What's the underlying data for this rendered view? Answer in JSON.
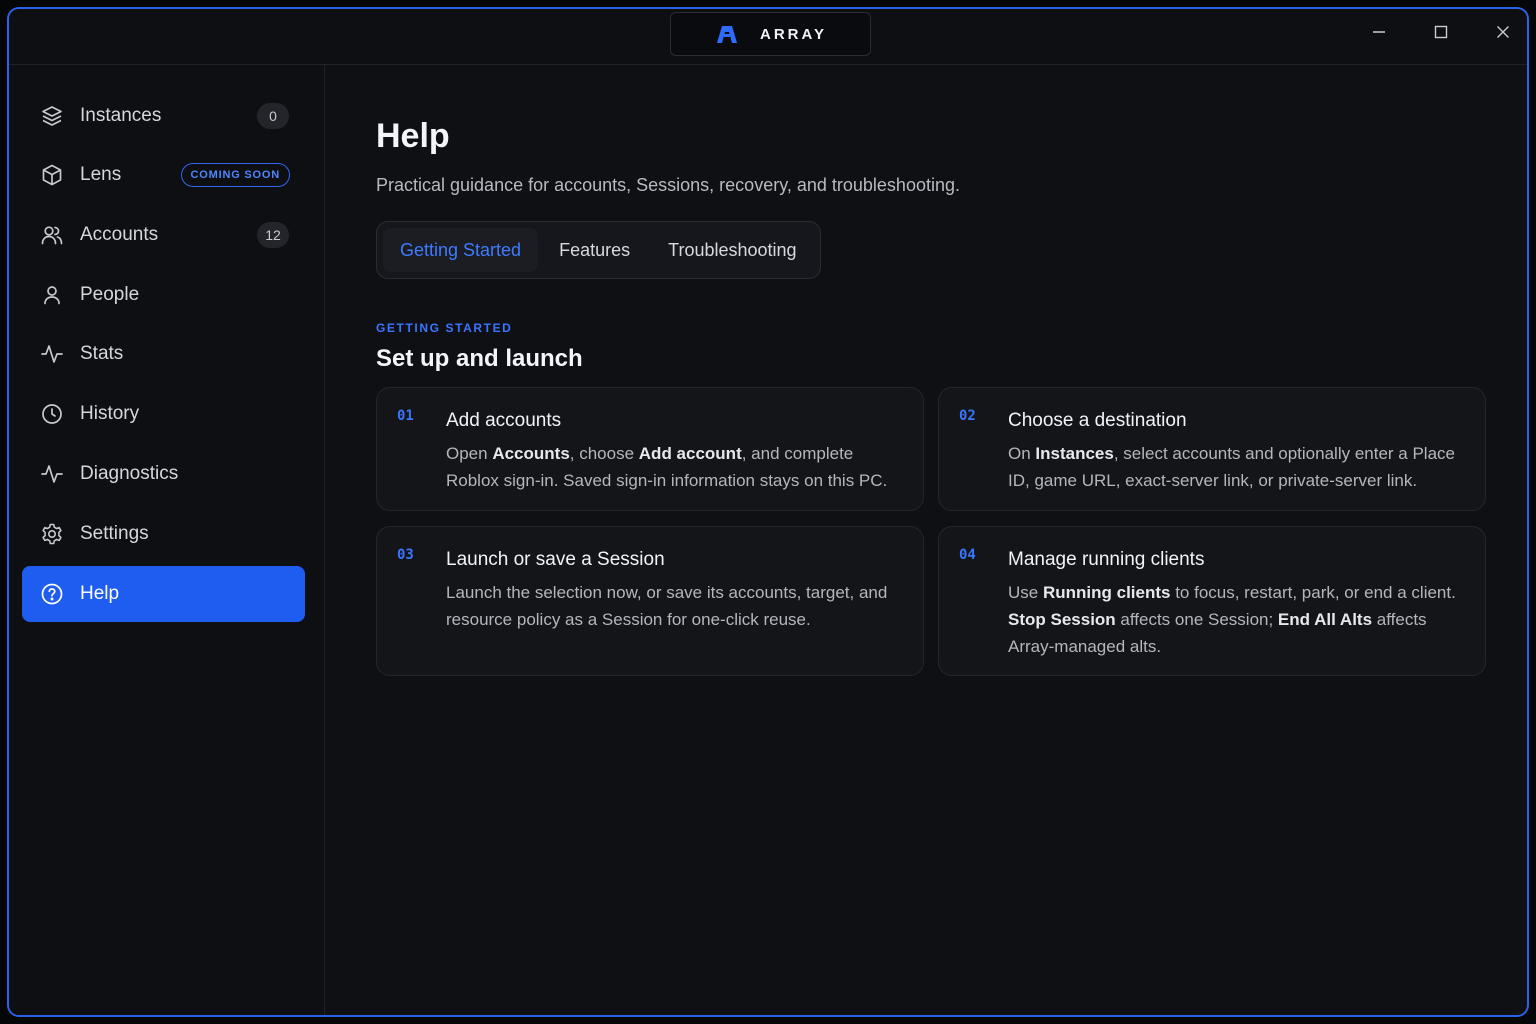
{
  "app": {
    "name": "ARRAY"
  },
  "window_controls": {
    "minimize": "minimize-icon",
    "maximize": "maximize-icon",
    "close": "close-icon"
  },
  "sidebar": {
    "items": [
      {
        "label": "Instances",
        "icon": "layers-icon",
        "badge": "0"
      },
      {
        "label": "Lens",
        "icon": "cube-icon",
        "tag": "COMING SOON"
      },
      {
        "label": "Accounts",
        "icon": "users-icon",
        "badge": "12"
      },
      {
        "label": "People",
        "icon": "user-icon"
      },
      {
        "label": "Stats",
        "icon": "activity-icon"
      },
      {
        "label": "History",
        "icon": "clock-icon"
      },
      {
        "label": "Diagnostics",
        "icon": "activity-icon"
      },
      {
        "label": "Settings",
        "icon": "gear-icon"
      },
      {
        "label": "Help",
        "icon": "help-circle-icon",
        "active": true
      }
    ]
  },
  "main": {
    "title": "Help",
    "subtitle": "Practical guidance for accounts, Sessions, recovery, and troubleshooting.",
    "tabs": [
      {
        "label": "Getting Started",
        "active": true
      },
      {
        "label": "Features"
      },
      {
        "label": "Troubleshooting"
      }
    ],
    "section": {
      "eyebrow": "GETTING STARTED",
      "title": "Set up and launch",
      "cards": [
        {
          "number": "01",
          "title": "Add accounts",
          "body": [
            {
              "text": "Open "
            },
            {
              "text": "Accounts",
              "bold": true
            },
            {
              "text": ", choose "
            },
            {
              "text": "Add account",
              "bold": true
            },
            {
              "text": ", and complete Roblox sign-in. Saved sign-in information stays on this PC."
            }
          ]
        },
        {
          "number": "02",
          "title": "Choose a destination",
          "body": [
            {
              "text": "On "
            },
            {
              "text": "Instances",
              "bold": true
            },
            {
              "text": ", select accounts and optionally enter a Place ID, game URL, exact-server link, or private-server link."
            }
          ]
        },
        {
          "number": "03",
          "title": "Launch or save a Session",
          "body": [
            {
              "text": "Launch the selection now, or save its accounts, target, and resource policy as a Session for one-click reuse."
            }
          ]
        },
        {
          "number": "04",
          "title": "Manage running clients",
          "body": [
            {
              "text": "Use "
            },
            {
              "text": "Running clients",
              "bold": true
            },
            {
              "text": " to focus, restart, park, or end a client. "
            },
            {
              "text": "Stop Session",
              "bold": true
            },
            {
              "text": " affects one Session; "
            },
            {
              "text": "End All Alts",
              "bold": true
            },
            {
              "text": " affects Array-managed alts."
            }
          ]
        }
      ]
    }
  },
  "colors": {
    "accent": "#1f5cf0",
    "accent_text": "#3a74ff",
    "window_border": "#2c62e8",
    "background": "#0f1014"
  }
}
